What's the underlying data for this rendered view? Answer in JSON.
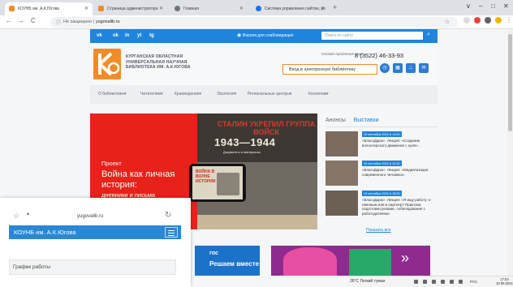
{
  "browser": {
    "tabs": [
      {
        "label": "КОУНБ им. А.К.Югова",
        "fav_color": "#f28c28"
      },
      {
        "label": "Страница администратора",
        "fav_color": "#f28c28"
      },
      {
        "label": "Главная",
        "fav_color": "#6f747a"
      },
      {
        "label": "Система управления сайтом, ро",
        "fav_color": "#1a73e8"
      }
    ],
    "new_tab": "+",
    "nav": {
      "back": "←",
      "forward": "→",
      "reload": "C"
    },
    "security_label": "Не защищено",
    "url_separator": "|",
    "url": "yugovalib.ru",
    "window_controls": {
      "caret": "∨",
      "minimize": "–",
      "maximize": "□",
      "close": "✕"
    }
  },
  "site": {
    "social": [
      "vk",
      "ok",
      "in",
      "yt",
      "tg"
    ],
    "low_vision_link": "Версия для слабовидящих",
    "search_placeholder": "Поиск по сайту",
    "library_name": "КУРГАНСКАЯ ОБЛАСТНАЯ УНИВЕРСАЛЬНАЯ НАУЧНАЯ БИБЛИОТЕКА ИМ. А.К.ЮГОВА",
    "consult_label": "Онлайн-продление книг",
    "phone": "8 (3522) 46-33-93",
    "elib_button": "Вход в электронную библиотеку",
    "menu": [
      "О библиотеке▾",
      "Читателям▾",
      "Краеведение▾",
      "Экология▾",
      "Региональные центры▾",
      "Коллегам▾"
    ],
    "banner": {
      "poster_title": "СТАЛИН УКРЕПИЛ ГРУППА ВОЙСК",
      "poster_years": "1943—1944",
      "poster_sub": "Документы и материалы",
      "screen_text": "ВОЙНА В ВОЛНЕ ИСТОРИИ",
      "project": "Проект",
      "title": "Война как личная история:",
      "subtitle": "дневники и письма"
    },
    "right_tabs": {
      "announcements": "Анонсы",
      "exhibitions": "Выставки"
    },
    "news": [
      {
        "date": "10 сентября 2021 в 14:00",
        "text": "«БлагоДарю». Лекция: «Создание волонтерского движения с нуля»."
      },
      {
        "date": "10 сентября 2021 в 15:30",
        "text": "«БлагоДарю». Лекция: «Медиатизация современного человека»."
      },
      {
        "date": "10 сентября 2021 в 18:00",
        "text": "«БлагоДарю». Лекция: «Я ищу работу: к-нвенным или в партнер? Практика подготовки резюме, собеседование с работодателем»"
      }
    ],
    "show_all": "Показать все",
    "gos_banner": {
      "line1": "гос",
      "line2": "Решаем вместе"
    }
  },
  "mobile_overlay": {
    "url": "yugovalib.ru",
    "title": "КОУНБ им. А.К.Югова",
    "item": "График работы"
  },
  "taskbar": {
    "weather": "26°C  Легкий туман",
    "lang": "РУС",
    "time": "17:03",
    "date": "10.09.2021"
  }
}
